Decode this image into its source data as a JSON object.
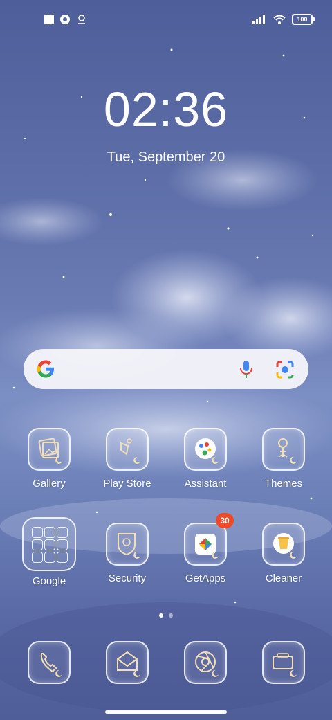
{
  "status_bar": {
    "icons_left": [
      "square-icon",
      "circle-icon",
      "location-icon"
    ],
    "icons_right": [
      "signal-icon",
      "wifi-icon"
    ],
    "battery": "100"
  },
  "lock": {
    "time": "02:36",
    "date": "Tue, September 20"
  },
  "search": {
    "icons": [
      "google-g-icon",
      "mic-icon",
      "lens-icon"
    ]
  },
  "apps_row1": [
    {
      "label": "Gallery",
      "icon": "gallery-icon"
    },
    {
      "label": "Play Store",
      "icon": "play-store-icon"
    },
    {
      "label": "Assistant",
      "icon": "assistant-icon"
    },
    {
      "label": "Themes",
      "icon": "themes-icon"
    }
  ],
  "apps_row2": [
    {
      "label": "Google",
      "icon": "google-folder-icon"
    },
    {
      "label": "Security",
      "icon": "security-icon"
    },
    {
      "label": "GetApps",
      "icon": "getapps-icon",
      "badge": "30"
    },
    {
      "label": "Cleaner",
      "icon": "cleaner-icon"
    }
  ],
  "dock": [
    {
      "icon": "phone-icon"
    },
    {
      "icon": "messages-icon"
    },
    {
      "icon": "chrome-icon"
    },
    {
      "icon": "camera-icon"
    }
  ],
  "page_indicator": {
    "count": 2,
    "active": 1
  }
}
